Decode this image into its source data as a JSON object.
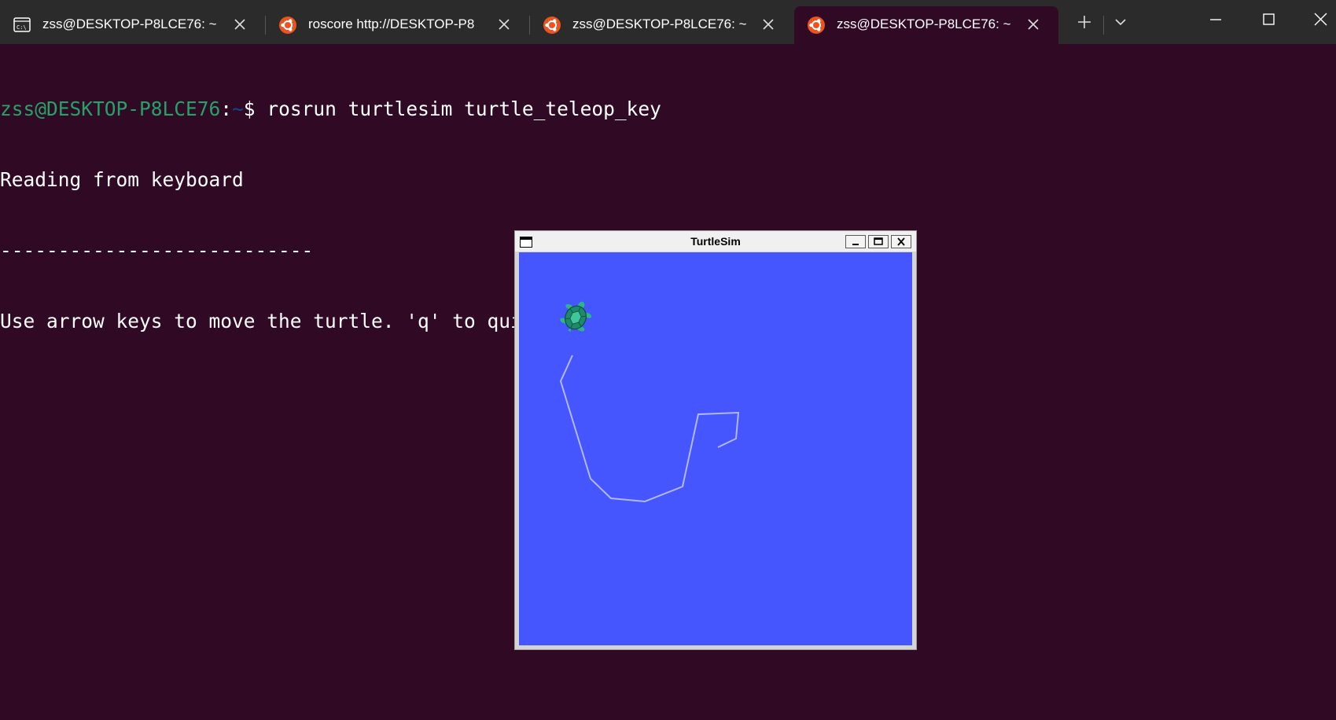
{
  "tabs": [
    {
      "label": "zss@DESKTOP-P8LCE76: ~",
      "icon": "cmd-icon",
      "active": false
    },
    {
      "label": "roscore http://DESKTOP-P8",
      "icon": "ubuntu-icon",
      "active": false
    },
    {
      "label": "zss@DESKTOP-P8LCE76: ~",
      "icon": "ubuntu-icon",
      "active": false
    },
    {
      "label": "zss@DESKTOP-P8LCE76: ~",
      "icon": "ubuntu-icon",
      "active": true
    }
  ],
  "tabbar_buttons": {
    "new_tab": "plus-icon",
    "dropdown": "chevron-down-icon"
  },
  "window_controls": [
    "minimize-icon",
    "maximize-icon",
    "close-icon"
  ],
  "terminal": {
    "prompt_user": "zss@DESKTOP-P8LCE76",
    "prompt_sep": ":",
    "prompt_path": "~",
    "prompt_symbol": "$ ",
    "command": "rosrun turtlesim turtle_teleop_key",
    "output": [
      "Reading from keyboard",
      "---------------------------",
      "Use arrow keys to move the turtle. 'q' to quit."
    ]
  },
  "turtlesim": {
    "title": "TurtleSim",
    "background": "#4556ff",
    "pen_color": "#b3b8ff",
    "turtle_color": "#2a9d7f"
  },
  "colors": {
    "terminal_bg": "#300a24",
    "tabbar_bg": "#2b2b2b",
    "user_green": "#26a269",
    "path_blue": "#12488b",
    "ubuntu_orange": "#e95420"
  }
}
